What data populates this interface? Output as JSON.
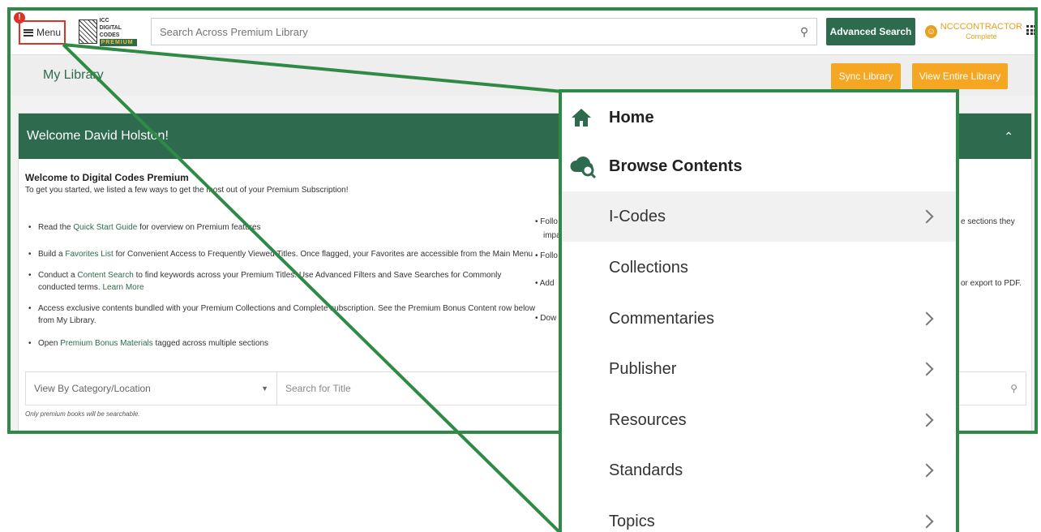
{
  "topbar": {
    "notification_count": "!",
    "menu_label": "Menu",
    "logo_line1": "DIGITAL CODES",
    "logo_line2": "PREMIUM",
    "logo_badge": "ICC",
    "search_placeholder": "Search Across Premium Library",
    "advanced_search_label": "Advanced Search",
    "username": "NCCCONTRACTOR",
    "subscription": "Complete"
  },
  "library_bar": {
    "title": "My Library",
    "sync_label": "Sync Library",
    "view_all_label": "View Entire Library"
  },
  "welcome_card": {
    "header": "Welcome David Holston!",
    "heading": "Welcome to Digital Codes Premium",
    "intro": "To get you started, we listed a few ways to get the most out of your Premium Subscription!",
    "bullets": [
      {
        "pre": "Read the ",
        "link": "Quick Start Guide",
        "post": " for overview on Premium features"
      },
      {
        "pre": "Build a ",
        "link": "Favorites List",
        "post": " for Convenient Access to Frequently Viewed Titles. Once flagged, your Favorites are accessible from the Main Menu"
      },
      {
        "pre": "Conduct a ",
        "link": "Content Search",
        "post": " to find keywords across your Premium Titles. Use Advanced Filters and Save Searches for Commonly conducted terms. ",
        "link2": "Learn More"
      },
      {
        "pre": "Access exclusive contents bundled with your Premium Collections and Complete subscription. See the Premium Bonus Content row below from My Library.",
        "link": "",
        "post": ""
      },
      {
        "pre": "Open ",
        "link": "Premium Bonus Materials",
        "post": " tagged across multiple sections"
      }
    ],
    "right_col": {
      "r1a": "• Follo",
      "r1b": "impa",
      "r1c": "e sections they",
      "r2": "• Follo",
      "r3a": "• Add",
      "r3b": "or export to PDF.",
      "r4": "• Dow"
    },
    "filter_label": "View By Category/Location",
    "title_search_placeholder": "Search for Title",
    "note": "Only premium books will be searchable."
  },
  "menu_panel": {
    "items": [
      {
        "label": "Home",
        "icon": "home-icon"
      },
      {
        "label": "Browse Contents",
        "icon": "cloud-search-icon"
      },
      {
        "label": "I-Codes",
        "icon": "chevron-right-icon"
      },
      {
        "label": "Collections"
      },
      {
        "label": "Commentaries",
        "icon": "chevron-right-icon"
      },
      {
        "label": "Publisher",
        "icon": "chevron-right-icon"
      },
      {
        "label": "Resources",
        "icon": "chevron-right-icon"
      },
      {
        "label": "Standards",
        "icon": "chevron-right-icon"
      },
      {
        "label": "Topics",
        "icon": "chevron-right-icon"
      }
    ]
  },
  "colors": {
    "brand_green": "#2e6b4e",
    "callout_green": "#2f8a45",
    "accent_orange": "#f5a623",
    "highlight_red": "#d9342b"
  }
}
